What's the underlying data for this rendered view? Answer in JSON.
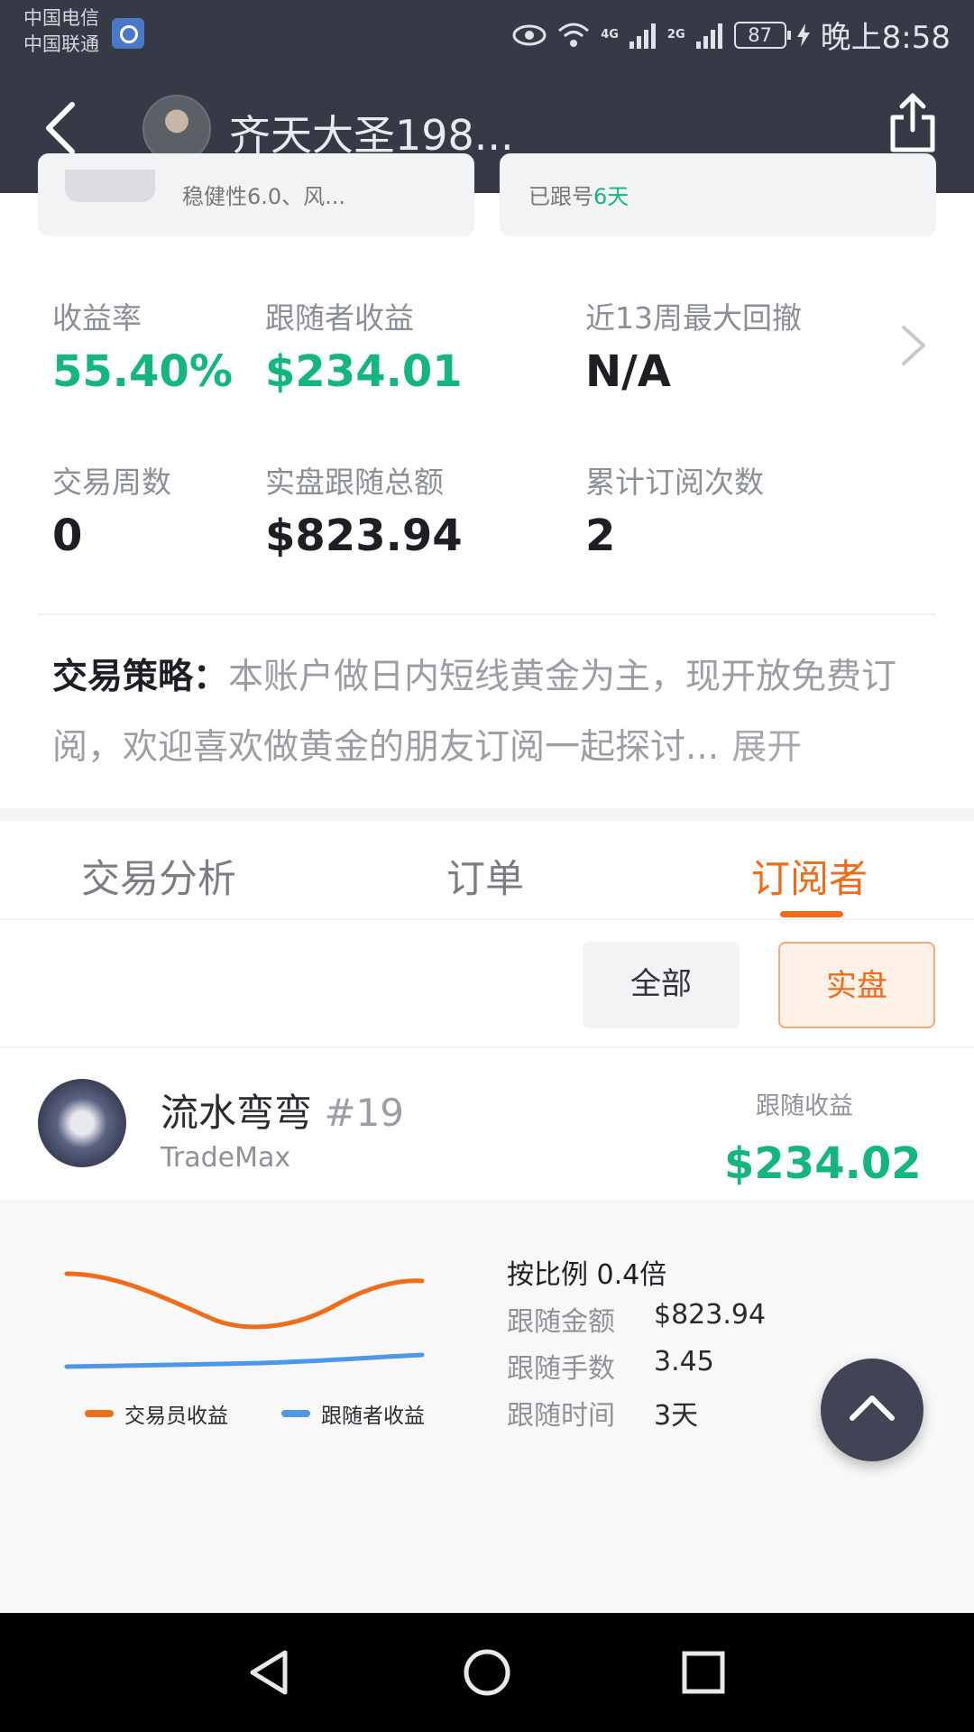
{
  "status_bar": {
    "carrier_1": "中国电信",
    "carrier_2": "中国联通",
    "network_1": "4G",
    "network_2": "2G",
    "battery": "87",
    "time": "晚上8:58"
  },
  "header": {
    "title": "齐天大圣198..."
  },
  "top_cards": {
    "card1_text": "稳健性6.0、风...",
    "card2_prefix": "已跟号",
    "card2_days": "6天"
  },
  "stats": [
    {
      "label": "收益率",
      "value": "55.40%"
    },
    {
      "label": "跟随者收益",
      "value": "$234.01"
    },
    {
      "label": "近13周最大回撤",
      "value": "N/A"
    },
    {
      "label": "交易周数",
      "value": "0"
    },
    {
      "label": "实盘跟随总额",
      "value": "$823.94"
    },
    {
      "label": "累计订阅次数",
      "value": "2"
    }
  ],
  "strategy": {
    "label": "交易策略：",
    "text": "本账户做日内短线黄金为主，现开放免费订阅，欢迎喜欢做黄金的朋友订阅一起探讨...",
    "expand": "展开"
  },
  "tabs": [
    "交易分析",
    "订单",
    "订阅者"
  ],
  "active_tab": "订阅者",
  "filters": {
    "all": "全部",
    "real": "实盘"
  },
  "subscriber": {
    "name": "流水弯弯",
    "rank": "#19",
    "broker": "TradeMax",
    "profit_label": "跟随收益",
    "profit_value": "$234.02",
    "ratio": "按比例 0.4倍",
    "details": [
      {
        "label": "跟随金额",
        "value": "$823.94"
      },
      {
        "label": "跟随手数",
        "value": "3.45"
      },
      {
        "label": "跟随时间",
        "value": "3天"
      }
    ]
  },
  "chart_data": {
    "type": "line",
    "series": [
      {
        "name": "交易员收益",
        "color": "#ef6c1a"
      },
      {
        "name": "跟随者收益",
        "color": "#4d97e8"
      }
    ]
  },
  "colors": {
    "accent": "#ef6c1a",
    "positive": "#14b57f",
    "header_bg": "#353a46"
  }
}
